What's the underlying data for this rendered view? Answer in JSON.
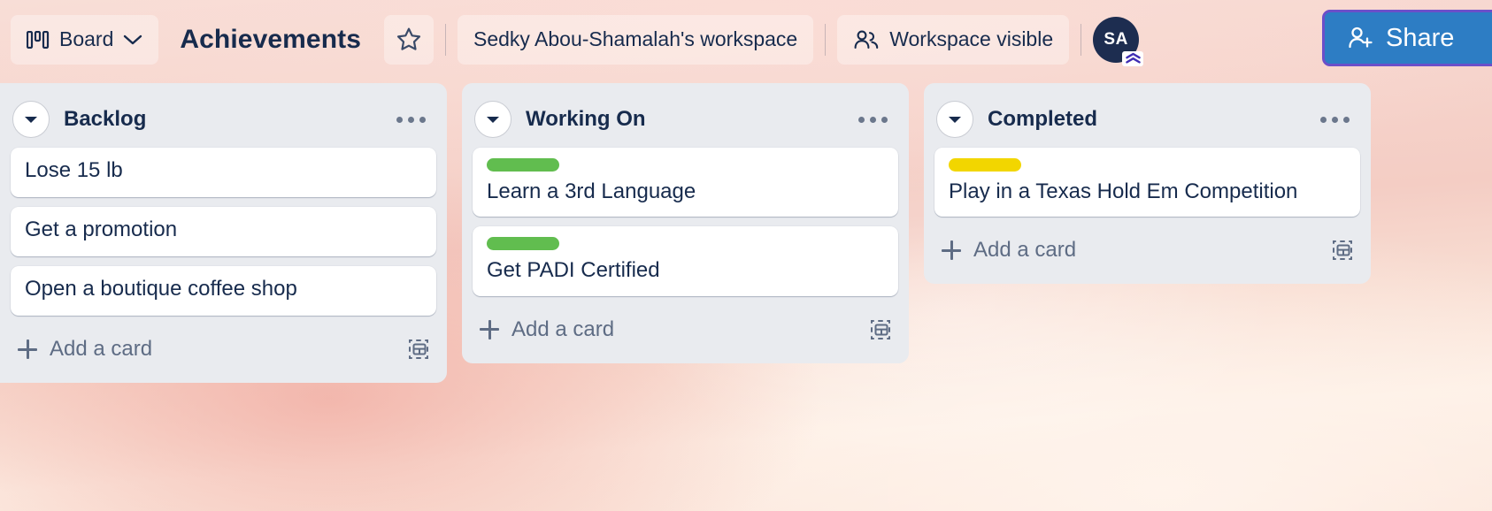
{
  "topbar": {
    "board_button_label": "Board",
    "board_button_icon": "board-view-icon",
    "board_button_chevron_icon": "chevron-down-icon",
    "board_title": "Achievements",
    "star_icon": "star-icon",
    "workspace_name": "Sedky Abou-Shamalah's workspace",
    "visibility_label": "Workspace visible",
    "visibility_icon": "people-icon",
    "avatar_initials": "SA",
    "avatar_badge_icon": "premium-chevrons-icon",
    "share_label": "Share",
    "share_icon": "person-add-icon",
    "share_button_color": "#2d7dc4",
    "share_focus_ring_color": "#6b4fc9"
  },
  "board": {
    "list_background_color": "#e9ebef",
    "lists": [
      {
        "title": "Backlog",
        "collapse_icon": "triangle-down-icon",
        "menu_icon": "more-horizontal-icon",
        "add_card_label": "Add a card",
        "template_icon": "card-template-icon",
        "cards": [
          {
            "title": "Lose 15 lb",
            "labels": []
          },
          {
            "title": "Get a promotion",
            "labels": []
          },
          {
            "title": "Open a boutique coffee shop",
            "labels": []
          }
        ]
      },
      {
        "title": "Working On",
        "collapse_icon": "triangle-down-icon",
        "menu_icon": "more-horizontal-icon",
        "add_card_label": "Add a card",
        "template_icon": "card-template-icon",
        "cards": [
          {
            "title": "Learn a 3rd Language",
            "labels": [
              "#61bd4f"
            ]
          },
          {
            "title": "Get PADI Certified",
            "labels": [
              "#61bd4f"
            ]
          }
        ]
      },
      {
        "title": "Completed",
        "collapse_icon": "triangle-down-icon",
        "menu_icon": "more-horizontal-icon",
        "add_card_label": "Add a card",
        "template_icon": "card-template-icon",
        "cards": [
          {
            "title": "Play in a Texas Hold Em Competition",
            "labels": [
              "#f2d600"
            ]
          }
        ]
      }
    ]
  }
}
